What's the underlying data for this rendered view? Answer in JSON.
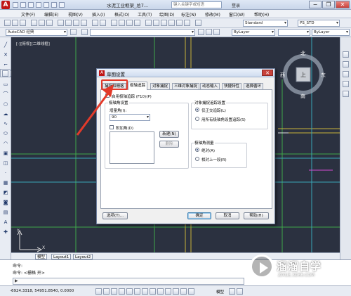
{
  "window": {
    "title": "水泥工业框架_总7...",
    "search_placeholder": "键入关键字或短语",
    "login": "登录",
    "minimize": "−",
    "restore": "❐",
    "close": "✕"
  },
  "menu": [
    {
      "label": "文件(F)"
    },
    {
      "label": "编辑(E)"
    },
    {
      "label": "视图(V)"
    },
    {
      "label": "插入(I)"
    },
    {
      "label": "格式(O)"
    },
    {
      "label": "工具(T)"
    },
    {
      "label": "绘图(D)"
    },
    {
      "label": "标注(N)"
    },
    {
      "label": "修改(M)"
    },
    {
      "label": "窗口(W)"
    },
    {
      "label": "帮助(H)"
    }
  ],
  "toolbar": {
    "workspace": "AutoCAD 经典",
    "text_style": "Standard",
    "dim_style": "PS_STD",
    "layer_color": "ByLayer",
    "layer_linetype": "ByLayer",
    "layer_lineweight": "ByLayer"
  },
  "canvas": {
    "viewport_label": "[-][俯视][二维线框]",
    "compass": {
      "north": "北",
      "south": "南",
      "east": "东",
      "west": "西",
      "center": "上"
    }
  },
  "layout_tabs": [
    "模型",
    "Layout1",
    "Layout2"
  ],
  "command": {
    "line1": "命令:",
    "line2": "命令: <栅格 开>",
    "prompt_icon": "▶"
  },
  "status": {
    "coords": "-6924.3318, 54951.8540, 0.0000",
    "model": "模型"
  },
  "dialog": {
    "title": "草图设置",
    "close": "✕",
    "tabs": [
      {
        "label": "捕捉和栅格",
        "active": false
      },
      {
        "label": "极轴追踪",
        "active": true
      },
      {
        "label": "对象捕捉",
        "active": false
      },
      {
        "label": "三维对象捕捉",
        "active": false
      },
      {
        "label": "动态输入",
        "active": false
      },
      {
        "label": "快捷特性",
        "active": false
      },
      {
        "label": "选择循环",
        "active": false
      }
    ],
    "enable_polar": {
      "label": "启用极轴追踪 (F10)(P)",
      "checked": false
    },
    "polar_angle": {
      "group_title": "极轴角设置",
      "increment_label": "增量角(I):",
      "increment_value": "90",
      "additional_label": "附加角(D)",
      "additional_checked": false,
      "new_button": "新建(N)",
      "delete_button": "删除"
    },
    "object_snap_tracking": {
      "group_title": "对象捕捉追踪设置",
      "option1": "仅正交追踪(L)",
      "option2": "用所有极轴角设置追踪(S)",
      "selected": 1
    },
    "polar_measurement": {
      "group_title": "极轴角测量",
      "option1": "绝对(A)",
      "option2": "相对上一段(R)",
      "selected": 1
    },
    "buttons": {
      "options": "选项(T)...",
      "ok": "确定",
      "cancel": "取消",
      "help": "帮助(H)"
    }
  },
  "watermark": {
    "brand": "溜溜自学",
    "url": "ZIXUE.3D66.COM"
  },
  "colors": {
    "canvas_bg": "#2b3140",
    "line_green": "#3fa84a",
    "line_yellow": "#c8b23a",
    "line_cyan": "#3aa6b8",
    "arrow_red": "#e23a2a"
  }
}
